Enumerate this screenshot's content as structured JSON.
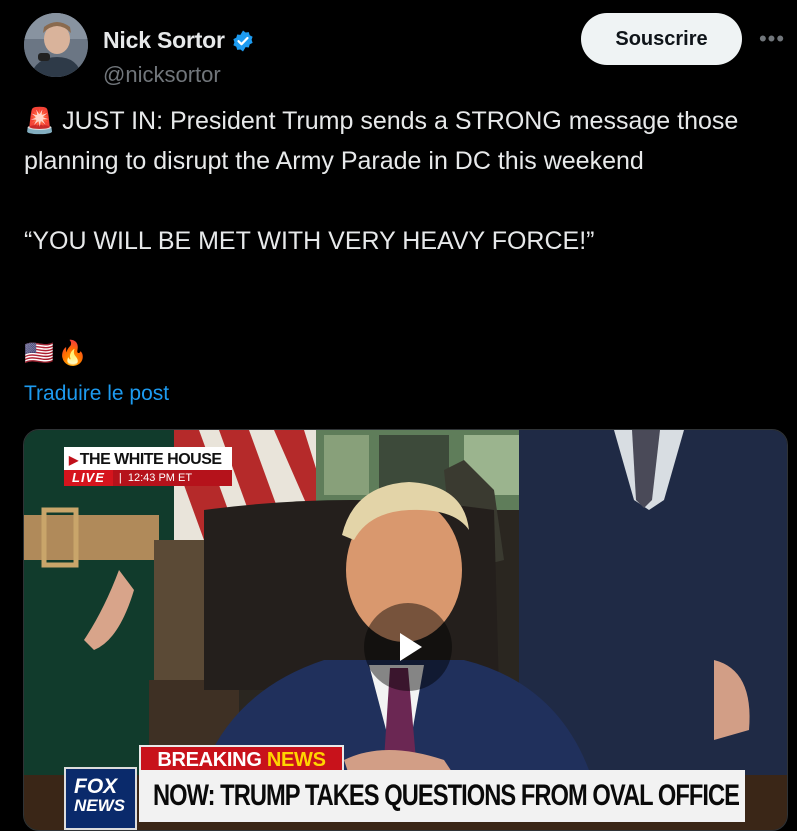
{
  "author": {
    "display_name": "Nick Sortor",
    "handle": "@nicksortor",
    "verified_icon": "verified-badge-icon",
    "avatar_icon": "avatar"
  },
  "actions": {
    "subscribe_label": "Souscrire",
    "more_label": "•••"
  },
  "tweet": {
    "siren_icon": "🚨",
    "line1": "JUST IN: President Trump sends a STRONG message those planning to disrupt the Army Parade in DC this weekend",
    "quote": "“YOU WILL BE MET WITH VERY HEAVY FORCE!”",
    "emojis": [
      "🇺🇸",
      "🔥"
    ],
    "translate_label": "Traduire le post"
  },
  "video": {
    "wh_title": "THE WHITE HOUSE",
    "live_label": "LIVE",
    "time_sep": "|",
    "time": "12:43 PM ET",
    "breaking_word": "BREAKING",
    "breaking_news": "NEWS",
    "chyron": "NOW: TRUMP TAKES QUESTIONS FROM OVAL OFFICE",
    "logo_line1": "FOX",
    "logo_line2": "NEWS",
    "play_icon": "play-icon"
  },
  "colors": {
    "background": "#000000",
    "text": "#e7e9ea",
    "secondary": "#71767b",
    "link": "#1d9bf0",
    "verified": "#1d9bf0"
  }
}
